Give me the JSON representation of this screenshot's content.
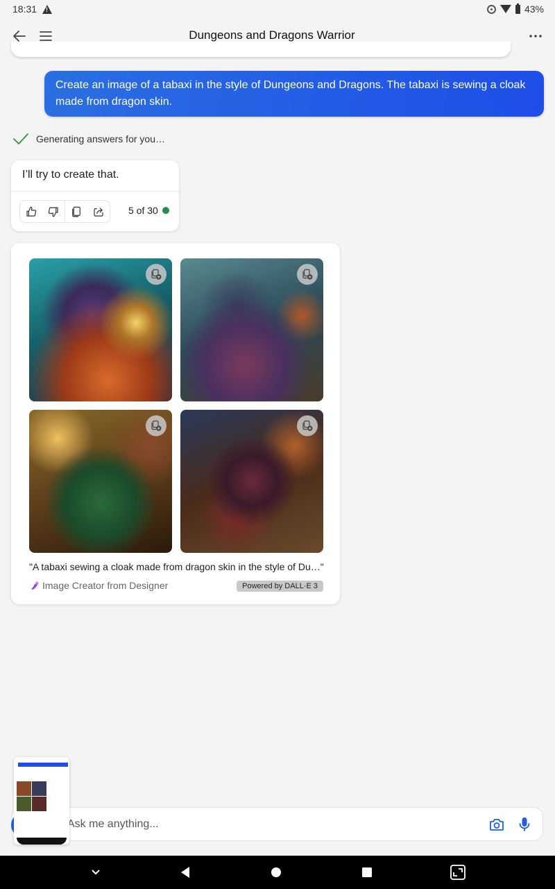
{
  "status_bar": {
    "time": "18:31",
    "battery": "43%",
    "icons": [
      "warning-icon",
      "sync-icon",
      "wifi-icon",
      "battery-icon"
    ]
  },
  "app_bar": {
    "title": "Dungeons and Dragons Warrior",
    "icons": [
      "back-arrow-icon",
      "hamburger-menu-icon",
      "more-options-icon"
    ]
  },
  "conversation": {
    "user_message": "Create an image of a tabaxi in the style of Dungeons and Dragons. The tabaxi is sewing a cloak made from dragon skin.",
    "status_text": "Generating answers for you…",
    "reply": {
      "text": "I’ll try to create that.",
      "actions": [
        "thumbs-up-icon",
        "thumbs-down-icon",
        "copy-icon",
        "share-icon"
      ],
      "turn_counter": "5 of 30",
      "turn_indicator_color": "#2a8a4a"
    },
    "image_result": {
      "images": [
        {
          "alt": "Tabaxi in purple hood sewing orange dragon-scale cloak"
        },
        {
          "alt": "Tabaxi in dark cloak sewing purple dragon-scale fabric"
        },
        {
          "alt": "Tabaxi in green dragon-scale cloak at sewing machine"
        },
        {
          "alt": "Tabaxi in dark red robe sewing red leather at table"
        }
      ],
      "caption": "\"A tabaxi sewing a cloak made from dragon skin in the style of Du…\"",
      "creator": "Image Creator from Designer",
      "badge": "Powered by DALL·E 3"
    }
  },
  "input": {
    "placeholder": "Ask me anything...",
    "value": "",
    "accent": "#1e5fe6"
  },
  "nav_bar": {
    "buttons": [
      "collapse",
      "back",
      "home",
      "recents",
      "screenshot"
    ]
  }
}
